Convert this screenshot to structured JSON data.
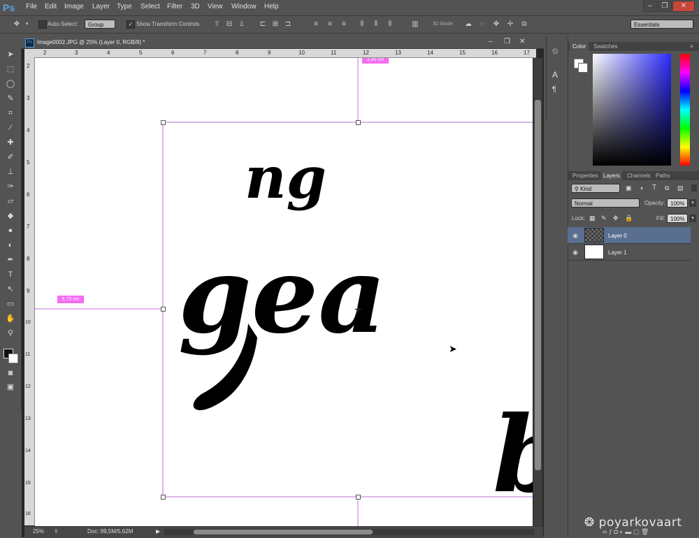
{
  "app": {
    "logo": "Ps"
  },
  "menu": [
    "File",
    "Edit",
    "Image",
    "Layer",
    "Type",
    "Select",
    "Filter",
    "3D",
    "View",
    "Window",
    "Help"
  ],
  "options": {
    "auto_select_label": "Auto-Select:",
    "auto_select_value": "Group",
    "show_transform_label": "Show Transform Controls",
    "mode_3d_label": "3D Mode:",
    "workspace": "Essentials"
  },
  "document": {
    "tab_title": "Image0002.JPG @ 25% (Layer 0, RGB/8) *",
    "ruler_top": [
      "2",
      "3",
      "4",
      "5",
      "6",
      "7",
      "8",
      "9",
      "10",
      "11",
      "12",
      "13",
      "14",
      "15",
      "16",
      "17"
    ],
    "ruler_left": [
      "2",
      "3",
      "4",
      "5",
      "6",
      "7",
      "8",
      "9",
      "10",
      "11",
      "12",
      "13",
      "14",
      "15",
      "16"
    ],
    "guide_label_top": "3,98 cm",
    "guide_label_left": "5,73 cm",
    "lettering": {
      "top": "ng",
      "middle": "gea",
      "right": "b"
    }
  },
  "status": {
    "zoom": "25%",
    "doc": "Doc: 99,5M/5,62M"
  },
  "panels": {
    "color_tabs": [
      "Color",
      "Swatches"
    ],
    "layer_tabs": [
      "Properties",
      "Layers",
      "Channels",
      "Paths"
    ],
    "kind_label": "Kind",
    "blend_mode": "Normal",
    "opacity_label": "Opacity:",
    "opacity_value": "100%",
    "lock_label": "Lock:",
    "fill_label": "Fill:",
    "fill_value": "100%",
    "layers": [
      {
        "name": "Layer 0",
        "selected": true
      },
      {
        "name": "Layer 1",
        "selected": false
      }
    ]
  },
  "watermark": "poyarkovaart",
  "colors": {
    "accent": "#f36df1",
    "selected_layer": "#5a6f8f",
    "ps_blue": "#5ba3e0"
  }
}
